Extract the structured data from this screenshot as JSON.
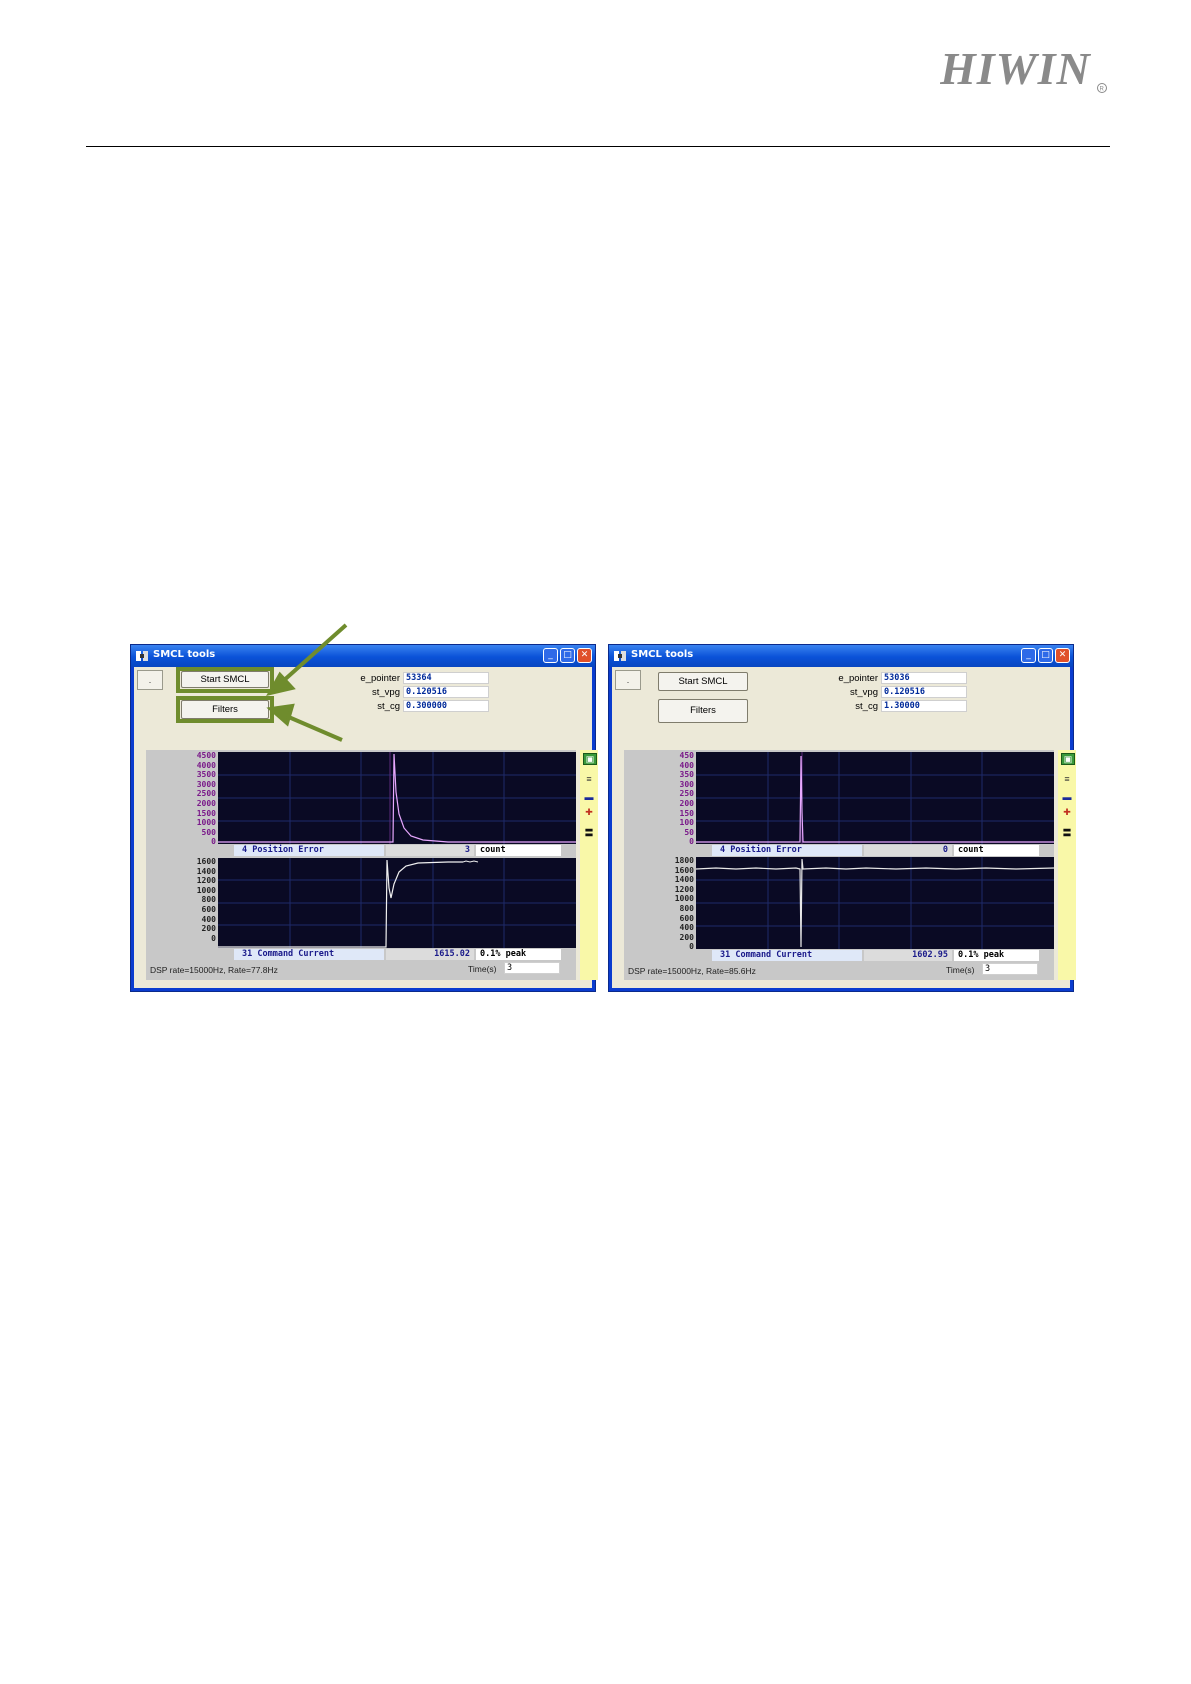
{
  "header": {
    "logo_text": "HIWIN"
  },
  "windows": [
    {
      "title": "SMCL tools",
      "small_button": ".",
      "start_button": "Start SMCL",
      "filters_button": "Filters",
      "params": [
        {
          "label": "e_pointer",
          "value": "53364"
        },
        {
          "label": "st_vpg",
          "value": "0.120516"
        },
        {
          "label": "st_cg",
          "value": "0.300000"
        }
      ],
      "top_ticks": [
        "4500",
        "4000",
        "3500",
        "3000",
        "2500",
        "2000",
        "1500",
        "1000",
        "500",
        "0"
      ],
      "top_channel": {
        "name": "4 Position Error",
        "value": "3",
        "unit": "count"
      },
      "bottom_ticks": [
        "1600",
        "1400",
        "1200",
        "1000",
        "800",
        "600",
        "400",
        "200",
        "0"
      ],
      "bottom_channel": {
        "name": "31 Command Current",
        "value": "1615.02",
        "unit": "0.1% peak"
      },
      "status": "DSP rate=15000Hz, Rate=77.8Hz",
      "time_label": "Time(s)",
      "time_value": "3"
    },
    {
      "title": "SMCL tools",
      "small_button": ".",
      "start_button": "Start SMCL",
      "filters_button": "Filters",
      "params": [
        {
          "label": "e_pointer",
          "value": "53036"
        },
        {
          "label": "st_vpg",
          "value": "0.120516"
        },
        {
          "label": "st_cg",
          "value": "1.30000"
        }
      ],
      "top_ticks": [
        "450",
        "400",
        "350",
        "300",
        "250",
        "200",
        "150",
        "100",
        "50",
        "0"
      ],
      "top_channel": {
        "name": "4 Position Error",
        "value": "0",
        "unit": "count"
      },
      "bottom_ticks": [
        "1800",
        "1600",
        "1400",
        "1200",
        "1000",
        "800",
        "600",
        "400",
        "200",
        "0"
      ],
      "bottom_channel": {
        "name": "31 Command Current",
        "value": "1602.95",
        "unit": "0.1% peak"
      },
      "status": "DSP rate=15000Hz, Rate=85.6Hz",
      "time_label": "Time(s)",
      "time_value": "3"
    }
  ]
}
